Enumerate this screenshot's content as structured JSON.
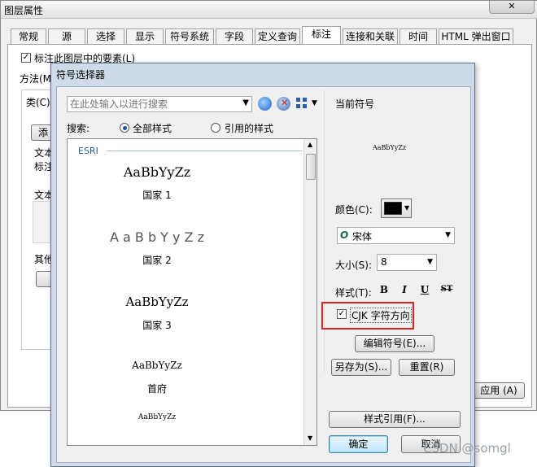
{
  "back_window": {
    "title": "图层属性",
    "tabs": [
      "常规",
      "源",
      "选择",
      "显示",
      "符号系统",
      "字段",
      "定义查询",
      "标注",
      "连接和关联",
      "时间",
      "HTML 弹出窗口"
    ],
    "active_tab": "标注",
    "label_checkbox": "标注此图层中的要素(L)",
    "method_label": "方法(M",
    "class_label": "类(C):",
    "add_btn": "添",
    "text_group1": "文本",
    "text_group1_b": "标注",
    "text_group2": "文本",
    "other_group": "其他",
    "apply_btn": "应用 (A)"
  },
  "dialog": {
    "title": "符号选择器",
    "search": {
      "placeholder": "在此处输入以进行搜索",
      "label": "搜索:",
      "option_all": "全部样式",
      "option_ref": "引用的样式"
    },
    "list": {
      "group_header": "ESRI",
      "items": [
        {
          "sample": "AaBbYyZz",
          "name": "国家 1"
        },
        {
          "sample": "A a B b Y y Z z",
          "name": "国家 2"
        },
        {
          "sample": "AaBbYyZz",
          "name": "国家 3"
        },
        {
          "sample": "AaBbYyZz",
          "name": "首府"
        },
        {
          "sample": "AaBbYyZz",
          "name": ""
        }
      ]
    },
    "current_symbol": {
      "label": "当前符号",
      "preview": "AaBbYyZz"
    },
    "color_label": "颜色(C):",
    "color_value": "#000000",
    "font_value": "宋体",
    "size_label": "大小(S):",
    "size_value": "8",
    "style_label": "样式(T):",
    "style_buttons": {
      "bold": "B",
      "italic": "I",
      "underline": "U",
      "strike": "ST"
    },
    "cjk_checkbox": "CJK 字符方向",
    "edit_symbol_btn": "编辑符号(E)...",
    "save_as_btn": "另存为(S)...",
    "reset_btn": "重置(R)",
    "style_ref_btn": "样式引用(F)...",
    "ok_btn": "确定",
    "cancel_btn": "取消"
  },
  "watermark": "CSDN @somgl",
  "highlight_color": "#e0201a"
}
